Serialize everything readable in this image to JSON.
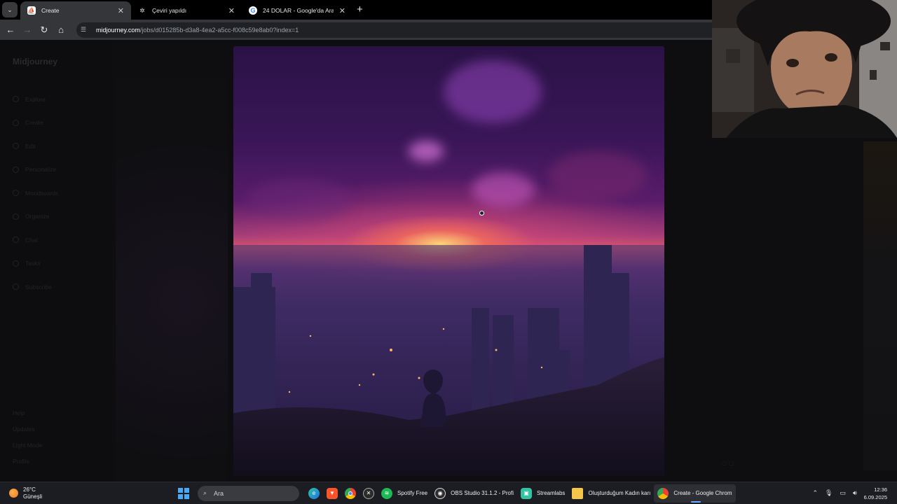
{
  "browser": {
    "tabs": [
      {
        "title": "Create",
        "active": true,
        "favicon": "midjourney-icon"
      },
      {
        "title": "Çeviri yapıldı",
        "active": false,
        "favicon": "openai-icon"
      },
      {
        "title": "24 DOLAR - Google'da Ara",
        "active": false,
        "favicon": "google-icon"
      }
    ],
    "url_host": "midjourney.com",
    "url_path": "/jobs/d015285b-d3a8-4ea2-a5cc-f008c59e8ab0?index=1"
  },
  "sidebar": {
    "logo": "Midjourney",
    "items": [
      {
        "label": "Explore"
      },
      {
        "label": "Create"
      },
      {
        "label": "Edit"
      },
      {
        "label": "Personalize"
      },
      {
        "label": "Moodboards"
      },
      {
        "label": "Organize"
      },
      {
        "label": "Chat"
      },
      {
        "label": "Tasks"
      },
      {
        "label": "Subscribe"
      }
    ],
    "bottom": [
      {
        "label": "Help"
      },
      {
        "label": "Updates"
      },
      {
        "label": "Light Mode"
      },
      {
        "label": "Profile"
      }
    ]
  },
  "image": {
    "description": "Generated image",
    "colors": {
      "sky_top": "#2a1245",
      "horizon": "#d4556e",
      "sun": "#ffdc78",
      "city": "#281c4a"
    }
  },
  "webcam": {
    "label": "streamer-webcam"
  },
  "taskbar": {
    "weather_temp": "26°C",
    "weather_desc": "Güneşli",
    "search_placeholder": "Ara",
    "apps": [
      {
        "name": "edge",
        "label": ""
      },
      {
        "name": "brave",
        "label": ""
      },
      {
        "name": "chrome",
        "label": ""
      },
      {
        "name": "xbox",
        "label": ""
      },
      {
        "name": "spotify",
        "label": "Spotify Free"
      },
      {
        "name": "obs",
        "label": "OBS Studio 31.1.2 - Profi"
      },
      {
        "name": "streamlabs",
        "label": "Streamlabs"
      },
      {
        "name": "explorer",
        "label": "Oluşturduğum Kadın karı"
      },
      {
        "name": "chrome-window",
        "label": "Create - Google Chrom"
      }
    ],
    "time": "12:36",
    "date": "6.09.2025"
  }
}
